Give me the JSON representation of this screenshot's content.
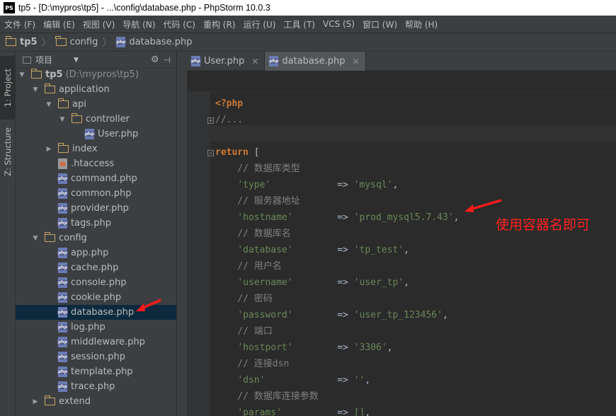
{
  "titlebar": {
    "app_icon": "PS",
    "title": "tp5 - [D:\\mypros\\tp5] - ...\\config\\database.php - PhpStorm 10.0.3"
  },
  "menu": [
    "文件 (F)",
    "编辑 (E)",
    "视图 (V)",
    "导航 (N)",
    "代码 (C)",
    "重构 (R)",
    "运行 (U)",
    "工具 (T)",
    "VCS (S)",
    "窗口 (W)",
    "帮助 (H)"
  ],
  "breadcrumb": [
    "tp5",
    "config",
    "database.php"
  ],
  "side_tabs": {
    "project": "1: Project",
    "structure": "Z: Structure"
  },
  "project_panel": {
    "title": "项目"
  },
  "tree": [
    {
      "label": "tp5",
      "extra": "(D:\\mypros\\tp5)",
      "type": "folder",
      "depth": 0,
      "expanded": true
    },
    {
      "label": "application",
      "type": "folder",
      "depth": 1,
      "expanded": true
    },
    {
      "label": "api",
      "type": "folder",
      "depth": 2,
      "expanded": true
    },
    {
      "label": "controller",
      "type": "folder",
      "depth": 3,
      "expanded": true
    },
    {
      "label": "User.php",
      "type": "php",
      "depth": 4
    },
    {
      "label": "index",
      "type": "folder",
      "depth": 2,
      "expanded": false
    },
    {
      "label": ".htaccess",
      "type": "htaccess",
      "depth": 2
    },
    {
      "label": "command.php",
      "type": "php",
      "depth": 2
    },
    {
      "label": "common.php",
      "type": "php",
      "depth": 2
    },
    {
      "label": "provider.php",
      "type": "php",
      "depth": 2
    },
    {
      "label": "tags.php",
      "type": "php",
      "depth": 2
    },
    {
      "label": "config",
      "type": "folder",
      "depth": 1,
      "expanded": true
    },
    {
      "label": "app.php",
      "type": "php",
      "depth": 2
    },
    {
      "label": "cache.php",
      "type": "php",
      "depth": 2
    },
    {
      "label": "console.php",
      "type": "php",
      "depth": 2
    },
    {
      "label": "cookie.php",
      "type": "php",
      "depth": 2
    },
    {
      "label": "database.php",
      "type": "php",
      "depth": 2,
      "selected": true
    },
    {
      "label": "log.php",
      "type": "php",
      "depth": 2
    },
    {
      "label": "middleware.php",
      "type": "php",
      "depth": 2
    },
    {
      "label": "session.php",
      "type": "php",
      "depth": 2
    },
    {
      "label": "template.php",
      "type": "php",
      "depth": 2
    },
    {
      "label": "trace.php",
      "type": "php",
      "depth": 2
    },
    {
      "label": "extend",
      "type": "folder",
      "depth": 1,
      "expanded": false
    }
  ],
  "editor_tabs": [
    {
      "label": "User.php",
      "active": false
    },
    {
      "label": "database.php",
      "active": true
    }
  ],
  "code": [
    {
      "kind": "open",
      "text": "<?php"
    },
    {
      "kind": "fold",
      "text": "//..."
    },
    {
      "kind": "blank",
      "text": ""
    },
    {
      "kind": "return",
      "kw": "return",
      "rest": " ["
    },
    {
      "kind": "comment",
      "text": "    // 数据库类型"
    },
    {
      "kind": "pair",
      "key": "'type'",
      "pad": "           ",
      "val": "'mysql'"
    },
    {
      "kind": "comment",
      "text": "    // 服务器地址"
    },
    {
      "kind": "pair",
      "key": "'hostname'",
      "pad": "       ",
      "val": "'prod_mysql5.7.43'"
    },
    {
      "kind": "comment",
      "text": "    // 数据库名"
    },
    {
      "kind": "pair",
      "key": "'database'",
      "pad": "       ",
      "val": "'tp_test'"
    },
    {
      "kind": "comment",
      "text": "    // 用户名"
    },
    {
      "kind": "pair",
      "key": "'username'",
      "pad": "       ",
      "val": "'user_tp'"
    },
    {
      "kind": "comment",
      "text": "    // 密码"
    },
    {
      "kind": "pair",
      "key": "'password'",
      "pad": "       ",
      "val": "'user_tp_123456'"
    },
    {
      "kind": "comment",
      "text": "    // 端口"
    },
    {
      "kind": "pair",
      "key": "'hostport'",
      "pad": "       ",
      "val": "'3306'"
    },
    {
      "kind": "comment",
      "text": "    // 连接dsn"
    },
    {
      "kind": "pair",
      "key": "'dsn'",
      "pad": "            ",
      "val": "''"
    },
    {
      "kind": "comment",
      "text": "    // 数据库连接参数"
    },
    {
      "kind": "pair",
      "key": "'params'",
      "pad": "         ",
      "val": "[]"
    }
  ],
  "annotation": {
    "text": "使用容器名即可",
    "color": "#ff2020"
  },
  "colors": {
    "keyword": "#cc7832",
    "string": "#6a8759",
    "comment": "#808080",
    "selection": "#0d293e",
    "folder": "#c8a76a"
  }
}
